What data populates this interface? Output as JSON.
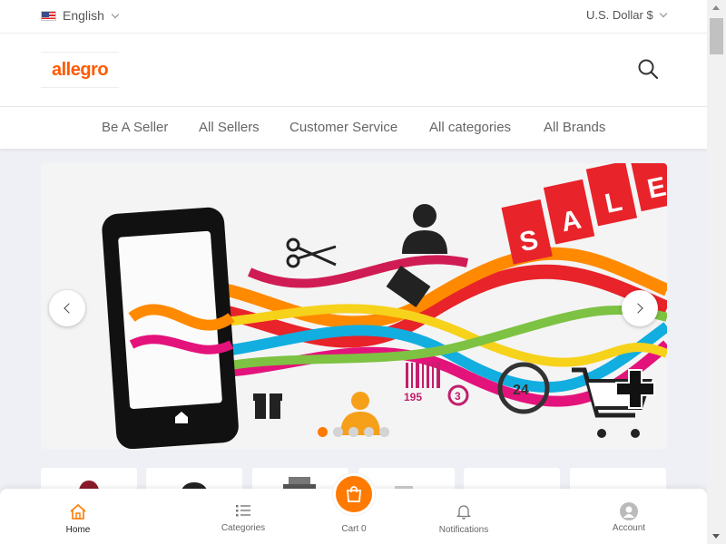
{
  "topbar": {
    "language": "English",
    "currency": "U.S. Dollar $"
  },
  "header": {
    "logo_text": "allegro"
  },
  "nav": {
    "items": [
      "Be A Seller",
      "All Sellers",
      "Customer Service",
      "All categories",
      "All Brands"
    ]
  },
  "banner": {
    "sale_letters": [
      "S",
      "A",
      "L",
      "E"
    ],
    "barcode_number": "195",
    "badge_24": "24",
    "badge_3": "3",
    "slide_count": 5,
    "active_slide": 1
  },
  "bottom_nav": {
    "home": "Home",
    "categories": "Categories",
    "cart": "Cart 0",
    "notifications": "Notifications",
    "account": "Account"
  },
  "colors": {
    "accent": "#ff7a00",
    "logo": "#ff5a00",
    "sale_red": "#e8232a"
  }
}
